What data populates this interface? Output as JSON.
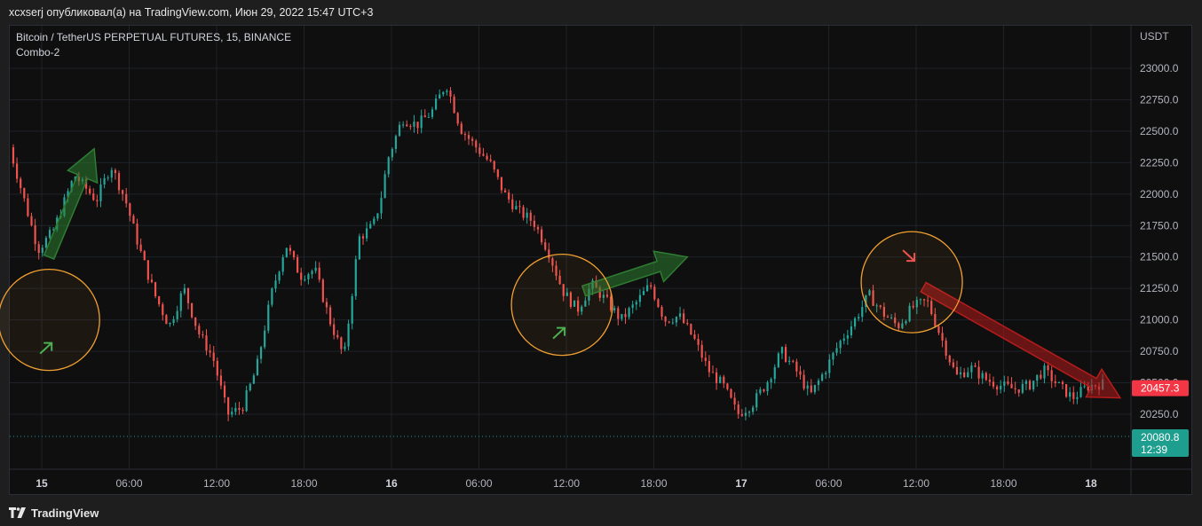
{
  "header": {
    "publish_line": "xcxserj опубликовал(а) на TradingView.com, Июн 29, 2022 15:47 UTC+3"
  },
  "footer": {
    "brand": "TradingView",
    "logo_icon": "tradingview-logo-icon"
  },
  "chart_data": {
    "type": "candlestick",
    "symbol_title": "Bitcoin / TetherUS PERPETUAL FUTURES, 15, BINANCE",
    "indicator": "Combo-2",
    "currency": "USDT",
    "ylim": [
      20030,
      23150
    ],
    "y_ticks": [
      "23000.0",
      "22750.0",
      "22500.0",
      "22250.0",
      "22000.0",
      "21750.0",
      "21500.0",
      "21250.0",
      "21000.0",
      "20750.0",
      "20500.0",
      "20250.0"
    ],
    "x_ticks": [
      {
        "label": "15",
        "bold": true,
        "t": 0
      },
      {
        "label": "06:00",
        "bold": false,
        "t": 6
      },
      {
        "label": "12:00",
        "bold": false,
        "t": 12
      },
      {
        "label": "18:00",
        "bold": false,
        "t": 18
      },
      {
        "label": "16",
        "bold": true,
        "t": 24
      },
      {
        "label": "06:00",
        "bold": false,
        "t": 30
      },
      {
        "label": "12:00",
        "bold": false,
        "t": 36
      },
      {
        "label": "18:00",
        "bold": false,
        "t": 42
      },
      {
        "label": "17",
        "bold": true,
        "t": 48
      },
      {
        "label": "06:00",
        "bold": false,
        "t": 54
      },
      {
        "label": "12:00",
        "bold": false,
        "t": 60
      },
      {
        "label": "18:00",
        "bold": false,
        "t": 66
      },
      {
        "label": "18",
        "bold": true,
        "t": 72
      }
    ],
    "price_path": [
      [
        -2.2,
        22480
      ],
      [
        -1.5,
        22180
      ],
      [
        0,
        21560
      ],
      [
        1,
        21700
      ],
      [
        2.5,
        22150
      ],
      [
        4,
        21950
      ],
      [
        5,
        22230
      ],
      [
        6,
        21950
      ],
      [
        7,
        21550
      ],
      [
        8,
        21200
      ],
      [
        9,
        20950
      ],
      [
        10,
        21250
      ],
      [
        11,
        20900
      ],
      [
        12,
        20700
      ],
      [
        13,
        20250
      ],
      [
        14,
        20300
      ],
      [
        15,
        20620
      ],
      [
        16,
        21200
      ],
      [
        17,
        21600
      ],
      [
        18,
        21350
      ],
      [
        19,
        21400
      ],
      [
        20,
        21000
      ],
      [
        21,
        20700
      ],
      [
        22,
        21650
      ],
      [
        23,
        21750
      ],
      [
        23.5,
        21950
      ],
      [
        24,
        22280
      ],
      [
        25,
        22600
      ],
      [
        26,
        22550
      ],
      [
        27,
        22650
      ],
      [
        28,
        22880
      ],
      [
        29,
        22520
      ],
      [
        30,
        22380
      ],
      [
        31,
        22250
      ],
      [
        32,
        22000
      ],
      [
        33,
        21860
      ],
      [
        34,
        21780
      ],
      [
        35,
        21550
      ],
      [
        36,
        21230
      ],
      [
        37,
        21080
      ],
      [
        38,
        21280
      ],
      [
        39,
        21150
      ],
      [
        40,
        21000
      ],
      [
        41,
        21130
      ],
      [
        42,
        21280
      ],
      [
        43,
        21000
      ],
      [
        44,
        21030
      ],
      [
        45,
        20850
      ],
      [
        46,
        20600
      ],
      [
        47,
        20480
      ],
      [
        48,
        20250
      ],
      [
        49,
        20330
      ],
      [
        50,
        20500
      ],
      [
        51,
        20750
      ],
      [
        52,
        20600
      ],
      [
        53,
        20400
      ],
      [
        54,
        20600
      ],
      [
        55,
        20820
      ],
      [
        56,
        20990
      ],
      [
        57,
        21200
      ],
      [
        58,
        21050
      ],
      [
        59,
        20950
      ],
      [
        60,
        21100
      ],
      [
        61,
        21150
      ],
      [
        62,
        20850
      ],
      [
        63,
        20550
      ],
      [
        64,
        20620
      ],
      [
        65,
        20530
      ],
      [
        66,
        20480
      ],
      [
        67,
        20450
      ],
      [
        68,
        20480
      ],
      [
        69,
        20600
      ],
      [
        70,
        20480
      ],
      [
        71,
        20380
      ],
      [
        72,
        20470
      ],
      [
        72.8,
        20490
      ]
    ],
    "last_price": "20457.3",
    "dotted_price": "20080.8",
    "countdown": "12:39",
    "dotted_price_value": 20080.8,
    "last_price_value": 20457.3,
    "colors": {
      "up": "#26a69a",
      "down": "#ef5350",
      "orange": "#f0a030",
      "green_arrow": "#2e7d32",
      "red_arrow": "#b71c1c",
      "price_badge": "#f23645",
      "dotted_badge": "#1e9e8e"
    },
    "annotations": [
      {
        "kind": "circle",
        "t": 0.5,
        "price": 21000,
        "icon": "up-right-arrow-icon",
        "icon_color": "#4caf50"
      },
      {
        "kind": "circle",
        "t": 35.7,
        "price": 21120,
        "icon": "up-right-arrow-icon",
        "icon_color": "#4caf50"
      },
      {
        "kind": "circle",
        "t": 59.7,
        "price": 21300,
        "icon": "down-right-arrow-icon",
        "icon_color": "#ef5350"
      },
      {
        "kind": "arrow",
        "from_t": 0.5,
        "from_p": 21500,
        "to_t": 3.6,
        "to_p": 22360,
        "color": "#2e7d32"
      },
      {
        "kind": "arrow",
        "from_t": 37.2,
        "from_p": 21230,
        "to_t": 44.3,
        "to_p": 21500,
        "color": "#2e7d32"
      },
      {
        "kind": "arrow",
        "from_t": 60.5,
        "from_p": 21260,
        "to_t": 74.0,
        "to_p": 20380,
        "color": "#b71c1c"
      }
    ]
  }
}
